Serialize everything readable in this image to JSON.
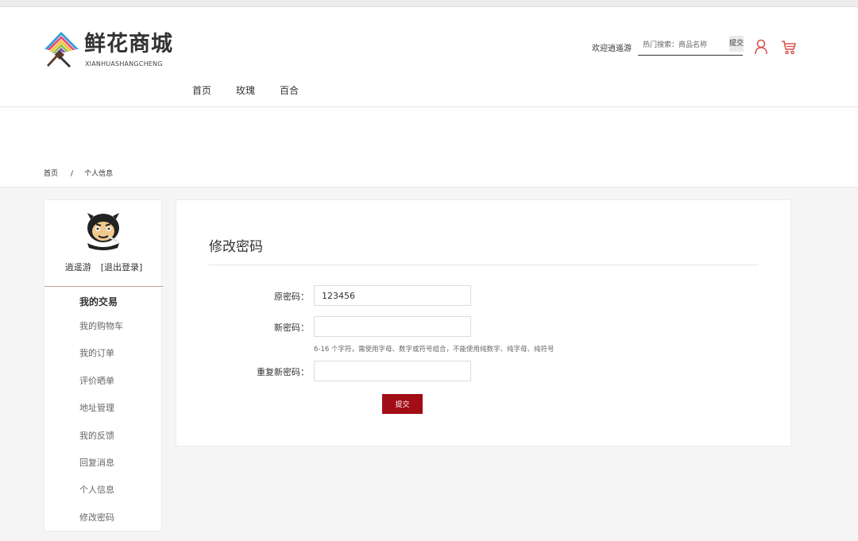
{
  "brand": {
    "title": "鲜花商城",
    "subtitle": "XIANHUASHANGCHENG"
  },
  "header": {
    "welcome": "欢迎逍遥游",
    "search_placeholder": "热门搜索：商品名称",
    "search_button": "提交",
    "user_icon": "user-icon",
    "cart_icon": "cart-icon",
    "accent_color": "#d9534f"
  },
  "nav": {
    "items": [
      {
        "label": "首页"
      },
      {
        "label": "玫瑰"
      },
      {
        "label": "百合"
      }
    ]
  },
  "breadcrumb": {
    "home": "首页",
    "separator": "/",
    "current": "个人信息"
  },
  "sidebar": {
    "username": "逍遥游",
    "logout": "[退出登录]",
    "section_title": "我的交易",
    "items": [
      {
        "label": "我的购物车"
      },
      {
        "label": "我的订单"
      },
      {
        "label": "评价晒单"
      },
      {
        "label": "地址管理"
      },
      {
        "label": "我的反馈"
      },
      {
        "label": "回复消息"
      },
      {
        "label": "个人信息"
      },
      {
        "label": "修改密码"
      }
    ]
  },
  "form": {
    "title": "修改密码",
    "old_password_label": "原密码：",
    "old_password_value": "123456",
    "new_password_label": "新密码：",
    "new_password_value": "",
    "hint": "6-16 个字符，需使用字母、数字或符号组合，不能使用纯数字、纯字母、纯符号",
    "repeat_password_label": "重复新密码：",
    "repeat_password_value": "",
    "submit_label": "提交",
    "submit_color": "#a10d16"
  }
}
